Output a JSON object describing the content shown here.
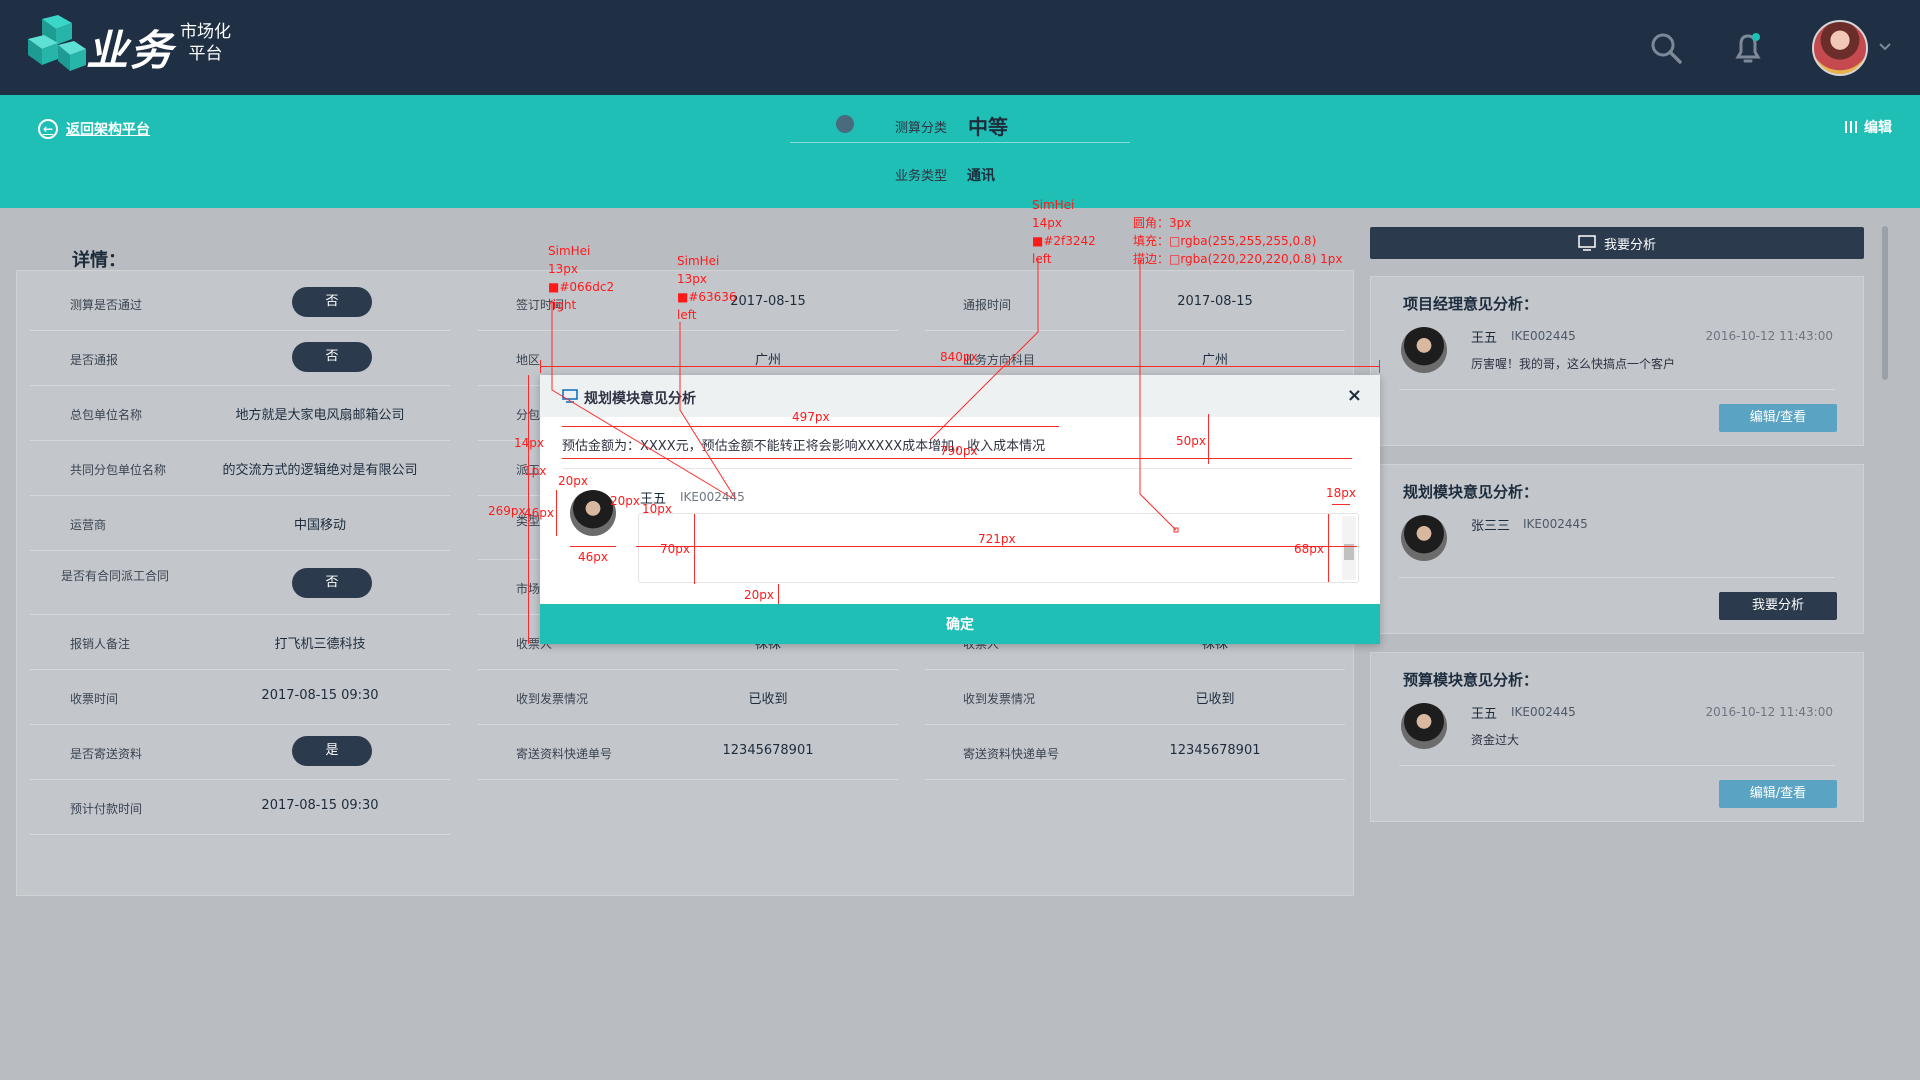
{
  "topbar": {
    "logo_main": "业务",
    "logo_sub_line1": "市场化",
    "logo_sub_line2": "平台",
    "icons": [
      "search-icon",
      "bell-icon",
      "chevron-down-icon"
    ]
  },
  "header": {
    "back_label": "返回架构平台",
    "calc_label": "测算分类",
    "calc_value": "中等",
    "biz_label": "业务类型",
    "biz_value": "通讯",
    "edit_label": "编辑"
  },
  "detail": {
    "title": "详情：",
    "col1": [
      {
        "label": "测算是否通过",
        "pill": "否"
      },
      {
        "label": "是否通报",
        "pill": "否"
      },
      {
        "label": "总包单位名称",
        "value": "地方就是大家电风扇邮箱公司"
      },
      {
        "label": "共同分包单位名称",
        "value": "的交流方式的逻辑绝对是有限公司"
      },
      {
        "label": "运营商",
        "value": "中国移动"
      },
      {
        "label": "是否有合同派工合同",
        "pill": "否"
      },
      {
        "label": "报销人备注",
        "value": "打飞机三德科技"
      },
      {
        "label": "收票时间",
        "value": "2017-08-15 09:30"
      },
      {
        "label": "是否寄送资料",
        "pill": "是"
      },
      {
        "label": "预计付款时间",
        "value": "2017-08-15 09:30"
      }
    ],
    "col2": [
      {
        "label": "签订时间",
        "value": "2017-08-15"
      },
      {
        "label": "地区",
        "value": "广州"
      },
      {
        "label": "分包",
        "value": ""
      },
      {
        "label": "派工",
        "value": ""
      },
      {
        "label": "类型",
        "value": ""
      },
      {
        "label": "市场",
        "value": ""
      },
      {
        "label": "收票人",
        "value": "袜袜"
      },
      {
        "label": "收到发票情况",
        "value": "已收到"
      },
      {
        "label": "寄送资料快递单号",
        "value": "12345678901"
      }
    ],
    "col3": [
      {
        "label": "通报时间",
        "value": "2017-08-15"
      },
      {
        "label": "业务方向科目",
        "value": "广州"
      },
      {
        "label": "",
        "value": ""
      },
      {
        "label": "",
        "value": ""
      },
      {
        "label": "",
        "value": ""
      },
      {
        "label": "",
        "value": ""
      },
      {
        "label": "收票人",
        "value": "袜袜"
      },
      {
        "label": "收到发票情况",
        "value": "已收到"
      },
      {
        "label": "寄送资料快递单号",
        "value": "12345678901"
      }
    ]
  },
  "sidebar": {
    "analyse_button": "我要分析",
    "cards": [
      {
        "title": "项目经理意见分析：",
        "name": "王五",
        "id": "IKE002445",
        "time": "2016-10-12 11:43:00",
        "text": "厉害喔！我的哥，这么快搞点一个客户",
        "button": "编辑/查看"
      },
      {
        "title": "规划模块意见分析：",
        "name": "张三三",
        "id": "IKE002445",
        "time": "",
        "text": "",
        "button": "我要分析"
      },
      {
        "title": "预算模块意见分析：",
        "name": "王五",
        "id": "IKE002445",
        "time": "2016-10-12 11:43:00",
        "text": "资金过大",
        "button": "编辑/查看"
      }
    ]
  },
  "modal": {
    "title": "规划模块意见分析",
    "close": "×",
    "description": "预估金额为：XXXX元，预估金额不能转正将会影响XXXXX成本增加，收入成本情况",
    "name": "王五",
    "id": "IKE002445",
    "confirm": "确定"
  },
  "annotations": {
    "font1": "SimHei",
    "size1": "13px",
    "color1": "■#066dc2",
    "align1": "right",
    "font2": "SimHei",
    "size2": "13px",
    "color2": "■#63636",
    "align2": "left",
    "font3": "SimHei",
    "size3": "14px",
    "color3": "■#2f3242",
    "align3": "left",
    "radius": "圆角：3px",
    "fill": "填充：□rgba(255,255,255,0.8)",
    "border": "描边：□rgba(220,220,220,0.8) 1px",
    "w840": "840px",
    "w497": "497px",
    "w790": "790px",
    "h50": "50px",
    "h14": "14px",
    "h1": "1px",
    "h20a": "20px",
    "h269": "269px",
    "h46a": "46px",
    "w20b": "20px",
    "h10": "10px",
    "w46": "46px",
    "h18": "18px",
    "w721": "721px",
    "h70": "70px",
    "h68": "68px",
    "h20c": "20px"
  },
  "colors": {
    "navy": "#1f2f44",
    "teal": "#1fbfb6",
    "pill": "#2b3a4c",
    "annotation": "#ff1a1a"
  }
}
